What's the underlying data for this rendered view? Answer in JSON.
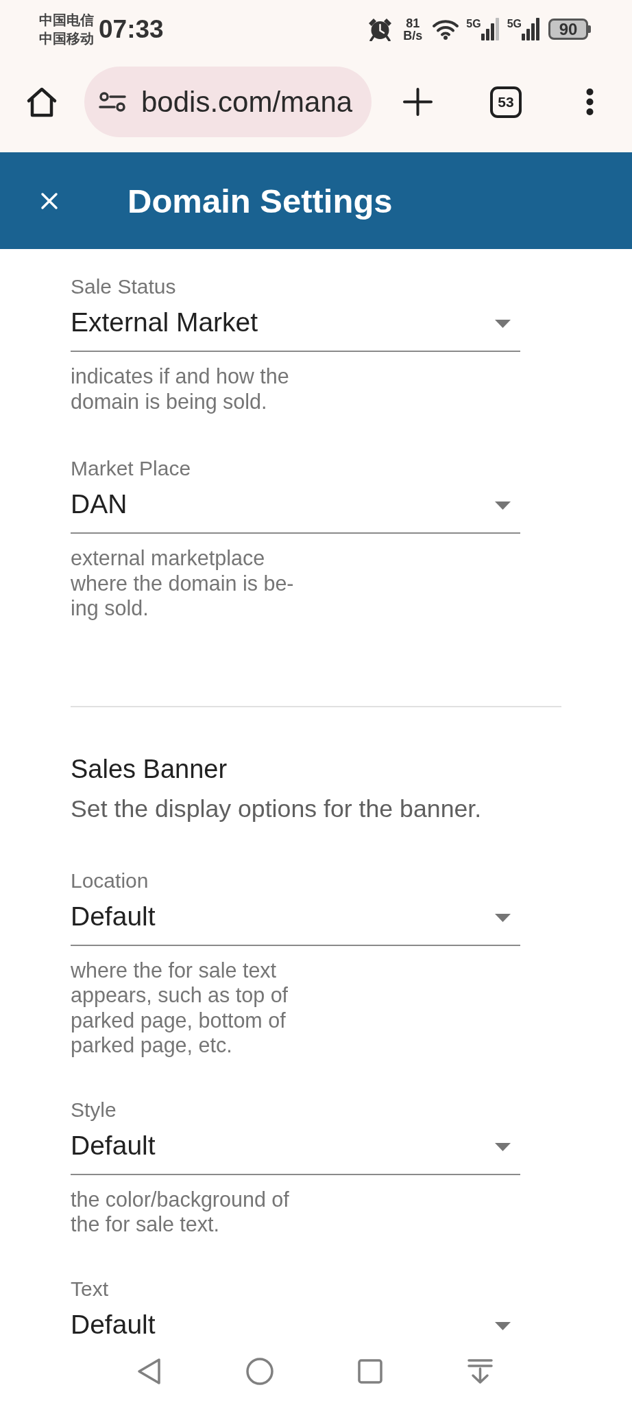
{
  "status_bar": {
    "carriers": [
      "中国电信",
      "中国移动"
    ],
    "time": "07:33",
    "net_speed": {
      "value": "81",
      "unit": "B/s"
    },
    "networks": [
      {
        "label": "5G"
      },
      {
        "label": "5G"
      }
    ],
    "battery": {
      "text": "90"
    }
  },
  "browser_toolbar": {
    "url": "bodis.com/mana",
    "tab_count": "53"
  },
  "header": {
    "title": "Domain Settings"
  },
  "sale_fields": [
    {
      "label": "Sale Status",
      "value": "External Market",
      "help": "indicates if and how the\ndomain is being sold."
    },
    {
      "label": "Market Place",
      "value": "DAN",
      "help": "external marketplace\nwhere the domain is be-\ning sold."
    }
  ],
  "banner_section": {
    "title": "Sales Banner",
    "description": "Set the display options for the banner.",
    "fields": [
      {
        "label": "Location",
        "value": "Default",
        "help": "where the for sale text\nappears, such as top of\nparked page, bottom of\nparked page, etc."
      },
      {
        "label": "Style",
        "value": "Default",
        "help": "the color/background of\nthe for sale text."
      },
      {
        "label": "Text",
        "value": "Default"
      }
    ]
  }
}
